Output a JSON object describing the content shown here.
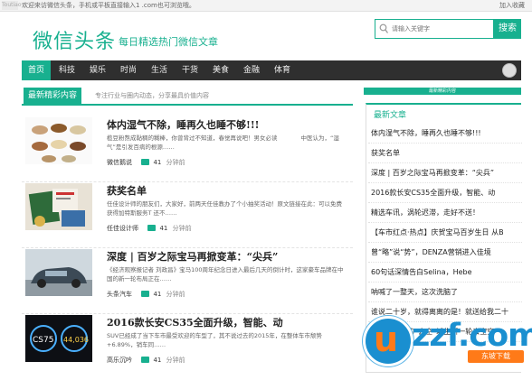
{
  "topbar": {
    "logo_mini": "Toutiao",
    "welcome": "欢迎来访微信头条，手机或平板直接输入1 .com也可浏览哦。",
    "favorite": "加入收藏"
  },
  "header": {
    "brand": "微信头条",
    "slogan": "每日精选热门微信文章",
    "search_placeholder": "请输入关键字",
    "search_button": "搜索"
  },
  "nav": {
    "items": [
      "首页",
      "科技",
      "娱乐",
      "时尚",
      "生活",
      "干货",
      "美食",
      "金融",
      "体育"
    ]
  },
  "section": {
    "tag": "最新精彩内容",
    "desc": "专注行业与圈内动态，分享最具价值内容"
  },
  "articles": [
    {
      "title": "体内湿气不除，睡再久也睡不够!!!",
      "summary1": "榄豆粉熬成黏稠的糊棒，你曾背过不知道，春觉再说吧！男女必读　　　　中医认为，“湿",
      "summary2": "气”是引发百病的根源……",
      "source": "微信鹅说",
      "views": "41",
      "time": "分钟前"
    },
    {
      "title": "获奖名单",
      "summary1": "任佳设计师的朋友们，大家好，前两天任佳教办了个小抽奖活动！原文链接在此：可以免费",
      "summary2": "获得加特斯服务T 还不……",
      "source": "任佳设计师",
      "views": "41",
      "time": "分钟前"
    },
    {
      "title": "深度 | 百岁之际宝马再掀变革：“尖兵”",
      "summary1": "《经济观察报记者 刘政昌》宝马100周年纪念日进入最后几天的倒计时，这家豪车品牌在中",
      "summary2": "国的新一轮布局正在……",
      "source": "头条汽车",
      "views": "41",
      "time": "分钟前"
    },
    {
      "title": "2016款长安CS35全面升级，智能、动",
      "summary1": "SUV已经成了当下车市最受欢迎的车型了，其不说过去的2015年，在整体车市颓势",
      "summary2": "+6.89%，销车同……",
      "source": "高乐沉吟",
      "views": "41",
      "time": "分钟前"
    }
  ],
  "sidebar": {
    "top_bar": "最新精彩内容",
    "title": "最新文章",
    "items": [
      "体内湿气不除，睡再久也睡不够!!!",
      "获奖名单",
      "深度 | 百岁之际宝马再掀变革：“尖兵”",
      "2016款长安CS35全面升级，智能、动",
      "精选车讯，涡轮迟滞，走好不送！",
      "【车市红点·热点】庆贺宝马百岁生日 从B",
      "曾“略”说“势”，DENZA营销进入佳境",
      "60句话深情告白Selina，Hebe",
      "呐喊了一整天，这次洗脑了",
      "谁说二十岁，就得离离的是！就送给我二十",
      "一眼就会卖的“去空”城生断一轮去空空"
    ]
  },
  "watermark": {
    "letter": "u",
    "brand": "zzf.com",
    "sub": "东坡下载"
  },
  "colors": {
    "accent": "#18b08f",
    "nav_bg": "#2f2f2f",
    "watermark_blue": "#1a8fd0",
    "watermark_orange": "#ff7a18"
  }
}
